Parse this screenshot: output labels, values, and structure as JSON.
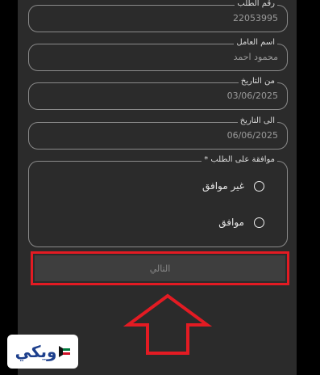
{
  "form": {
    "order_number": {
      "label": "رقم الطلب",
      "value": "22053995"
    },
    "worker_name": {
      "label": "اسم العامل",
      "value": "محمود احمد"
    },
    "from_date": {
      "label": "من التاريخ",
      "value": "03/06/2025"
    },
    "to_date": {
      "label": "الى التاريخ",
      "value": "06/06/2025"
    },
    "approval": {
      "label": "موافقة على الطلب *",
      "options": [
        {
          "label": "غير موافق",
          "selected": false
        },
        {
          "label": "موافق",
          "selected": false
        }
      ]
    },
    "next_label": "التالي"
  },
  "watermark": {
    "text": "ويكي"
  },
  "colors": {
    "panel": "#2b2b2b",
    "border": "#8a8a8a",
    "annotation_red": "#e31b23",
    "logo_blue": "#1d3f8c"
  }
}
